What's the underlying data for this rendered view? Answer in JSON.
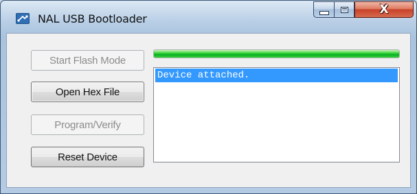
{
  "window": {
    "title": "NAL USB Bootloader",
    "icon": "usb-app-icon"
  },
  "caption_buttons": {
    "minimize_icon": "minimize-icon",
    "maximize_icon": "maximize-icon",
    "close_icon": "close-icon",
    "close_glyph": "X"
  },
  "buttons": {
    "start_flash_mode": "Start Flash Mode",
    "open_hex_file": "Open Hex File",
    "program_verify": "Program/Verify",
    "reset_device": "Reset Device"
  },
  "progress": {
    "value_percent": 100,
    "color": "#06b025"
  },
  "log": {
    "lines": [
      "Device attached."
    ],
    "selected_index": 0,
    "selection_color": "#3399ff"
  }
}
